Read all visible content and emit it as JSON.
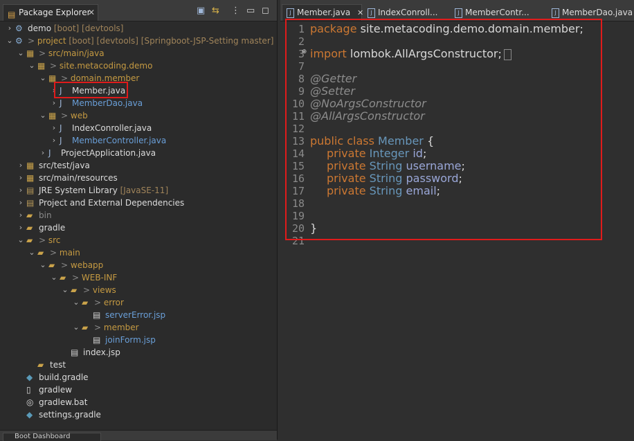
{
  "explorer": {
    "tab_label": "Package Explorer",
    "close_glyph": "✕",
    "tree": [
      {
        "label": "demo",
        "suffix": "[boot] [devtools]",
        "depth": 0,
        "arrow": "›",
        "icon": "project-icon"
      },
      {
        "label": "project",
        "prefix": ">",
        "suffix": "[boot] [devtools] [Springboot-JSP-Setting master]",
        "depth": 0,
        "arrow": "⌄",
        "icon": "project-icon"
      },
      {
        "label": "src/main/java",
        "prefix": ">",
        "depth": 1,
        "arrow": "⌄",
        "icon": "source-folder-icon"
      },
      {
        "label": "site.metacoding.demo",
        "prefix": ">",
        "depth": 2,
        "arrow": "⌄",
        "icon": "package-icon"
      },
      {
        "label": "domain.member",
        "prefix": ">",
        "depth": 3,
        "arrow": "⌄",
        "icon": "package-icon"
      },
      {
        "label": "Member.java",
        "depth": 4,
        "arrow": "›",
        "icon": "java-file-icon"
      },
      {
        "label": "MemberDao.java",
        "depth": 4,
        "arrow": "›",
        "icon": "java-file-icon"
      },
      {
        "label": "web",
        "prefix": ">",
        "depth": 3,
        "arrow": "⌄",
        "icon": "package-icon"
      },
      {
        "label": "IndexConroller.java",
        "depth": 4,
        "arrow": "›",
        "icon": "java-file-icon"
      },
      {
        "label": "MemberController.java",
        "depth": 4,
        "arrow": "›",
        "icon": "java-file-icon"
      },
      {
        "label": "ProjectApplication.java",
        "depth": 3,
        "arrow": "›",
        "icon": "java-file-icon"
      },
      {
        "label": "src/test/java",
        "depth": 1,
        "arrow": "›",
        "icon": "source-folder-icon"
      },
      {
        "label": "src/main/resources",
        "depth": 1,
        "arrow": "›",
        "icon": "source-folder-icon"
      },
      {
        "label": "JRE System Library",
        "suffix": "[JavaSE-11]",
        "depth": 1,
        "arrow": "›",
        "icon": "library-icon"
      },
      {
        "label": "Project and External Dependencies",
        "depth": 1,
        "arrow": "›",
        "icon": "library-icon"
      },
      {
        "label": "bin",
        "depth": 1,
        "arrow": "›",
        "icon": "folder-icon"
      },
      {
        "label": "gradle",
        "depth": 1,
        "arrow": "›",
        "icon": "folder-icon"
      },
      {
        "label": "src",
        "prefix": ">",
        "depth": 1,
        "arrow": "⌄",
        "icon": "folder-icon"
      },
      {
        "label": "main",
        "prefix": ">",
        "depth": 2,
        "arrow": "⌄",
        "icon": "folder-icon"
      },
      {
        "label": "webapp",
        "prefix": ">",
        "depth": 3,
        "arrow": "⌄",
        "icon": "folder-icon"
      },
      {
        "label": "WEB-INF",
        "prefix": ">",
        "depth": 4,
        "arrow": "⌄",
        "icon": "folder-icon"
      },
      {
        "label": "views",
        "prefix": ">",
        "depth": 5,
        "arrow": "⌄",
        "icon": "folder-icon"
      },
      {
        "label": "error",
        "prefix": ">",
        "depth": 6,
        "arrow": "⌄",
        "icon": "folder-icon"
      },
      {
        "label": "serverError.jsp",
        "depth": 7,
        "arrow": "",
        "icon": "jsp-file-icon"
      },
      {
        "label": "member",
        "prefix": ">",
        "depth": 6,
        "arrow": "⌄",
        "icon": "folder-icon"
      },
      {
        "label": "joinForm.jsp",
        "depth": 7,
        "arrow": "",
        "icon": "jsp-file-icon"
      },
      {
        "label": "index.jsp",
        "depth": 5,
        "arrow": "",
        "icon": "jsp-file-icon"
      },
      {
        "label": "test",
        "depth": 2,
        "arrow": "",
        "icon": "folder-icon"
      },
      {
        "label": "build.gradle",
        "depth": 1,
        "arrow": "",
        "icon": "gradle-file-icon"
      },
      {
        "label": "gradlew",
        "depth": 1,
        "arrow": "",
        "icon": "file-icon"
      },
      {
        "label": "gradlew.bat",
        "depth": 1,
        "arrow": "",
        "icon": "bat-file-icon"
      },
      {
        "label": "settings.gradle",
        "depth": 1,
        "arrow": "",
        "icon": "gradle-file-icon"
      }
    ],
    "bottom_tab_label": "Boot Dashboard"
  },
  "editor": {
    "tabs": [
      {
        "label": "Member.java",
        "close": "✕",
        "active": true
      },
      {
        "label": "IndexConroll..."
      },
      {
        "label": "MemberContr..."
      },
      {
        "label": "MemberDao.java"
      }
    ],
    "line_numbers": [
      "1",
      "2",
      "3",
      "7",
      "8",
      "9",
      "10",
      "11",
      "12",
      "13",
      "14",
      "15",
      "16",
      "17",
      "18",
      "19",
      "20",
      "21"
    ],
    "lines": {
      "l1_kw": "package",
      "l1_rest": " site.metacoding.demo.domain.member;",
      "l3_kw": "import",
      "l3_rest": " lombok.AllArgsConstructor;",
      "l8": "@Getter",
      "l9": "@Setter",
      "l10": "@NoArgsConstructor",
      "l11": "@AllArgsConstructor",
      "l13_kw": "public class",
      "l13_cls": "Member",
      "l13_rest": " {",
      "f1_kw": "private",
      "f1_ty": "Integer",
      "f1_name": "id",
      "f1_end": ";",
      "f2_kw": "private",
      "f2_ty": "String",
      "f2_name": "username",
      "f2_end": ";",
      "f3_kw": "private",
      "f3_ty": "String",
      "f3_name": "password",
      "f3_end": ";",
      "f4_kw": "private",
      "f4_ty": "String",
      "f4_name": "email",
      "f4_end": ";",
      "l20": "}"
    }
  },
  "colors": {
    "highlight": "#e01b1b",
    "keyword": "#cc7832",
    "type": "#6897bb",
    "annotation": "#8c8c8c"
  }
}
